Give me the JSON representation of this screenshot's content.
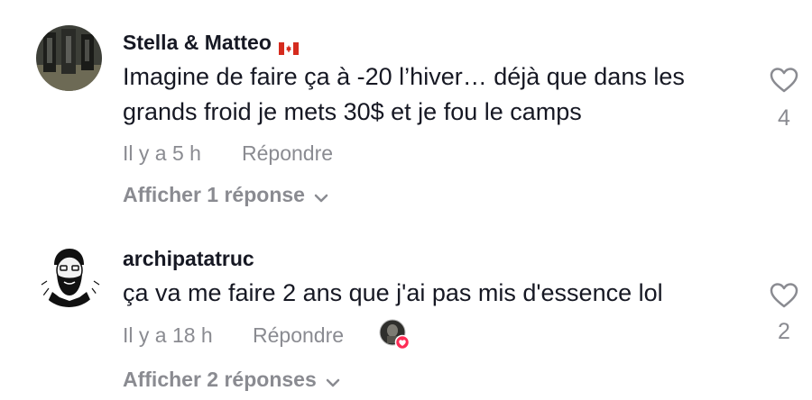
{
  "comments": [
    {
      "username": "Stella & Matteo",
      "flag": "canada-flag",
      "text": "Imagine de faire ça à -20 l’hiver… déjà que dans les grands froid je mets 30$ et je fou le camps",
      "time": "Il y a 5 h",
      "reply_label": "Répondre",
      "like_count": "4",
      "view_replies": "Afficher 1 réponse"
    },
    {
      "username": "archipatatruc",
      "text": "ça va me faire 2 ans que j'ai pas mis d'essence lol",
      "time": "Il y a 18 h",
      "reply_label": "Répondre",
      "like_count": "2",
      "creator_liked": true,
      "view_replies": "Afficher 2 réponses"
    }
  ],
  "colors": {
    "text": "#161823",
    "secondary": "#8a8b91",
    "heart_badge": "#fe2c55"
  }
}
